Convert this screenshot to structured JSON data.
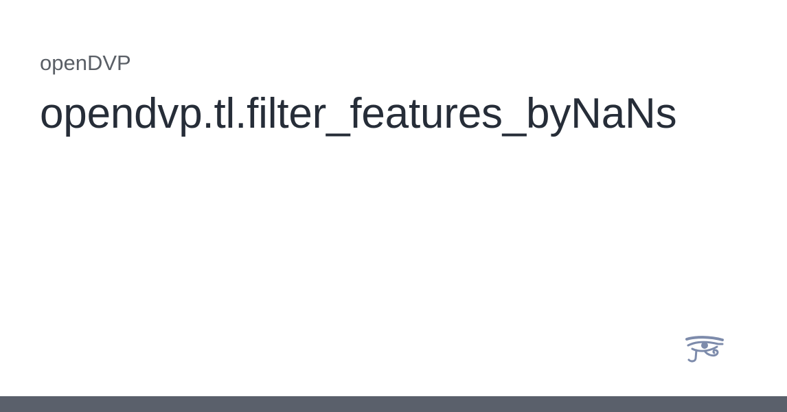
{
  "site": {
    "name": "openDVP"
  },
  "page": {
    "title": "opendvp.tl.filter_features_byNaNs"
  },
  "logo": {
    "icon": "eye-of-horus-icon",
    "color": "#7d8bab"
  },
  "colors": {
    "background": "#ffffff",
    "title_text": "#262d38",
    "site_name_text": "#5a5f66",
    "bottom_bar": "#5a606b"
  }
}
